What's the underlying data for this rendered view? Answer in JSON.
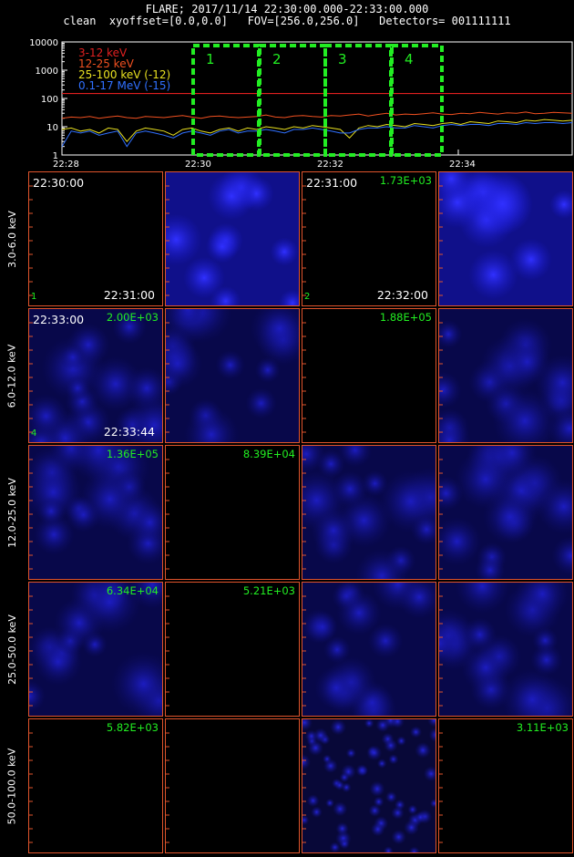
{
  "header": {
    "line1": "FLARE; 2017/11/14 22:30:00.000-22:33:00.000",
    "line2": "clean  xyoffset=[0.0,0.0]   FOV=[256.0,256.0]   Detectors= 001111111"
  },
  "chart_data": {
    "type": "line",
    "scale": "log",
    "ylim": [
      1,
      10000
    ],
    "y_ticks": [
      "10000",
      "1000",
      "100",
      "10",
      "1"
    ],
    "x_ticks": [
      "22:28",
      "22:30",
      "22:32",
      "22:34"
    ],
    "series": [
      {
        "name": "3-12 keV",
        "color": "#e02020",
        "value": 150
      },
      {
        "name": "12-25 keV",
        "color": "#f05020",
        "values": [
          20,
          22,
          21,
          23,
          20,
          22,
          24,
          21,
          20,
          23,
          22,
          21,
          23,
          25,
          22,
          20,
          23,
          24,
          22,
          21,
          22,
          23,
          26,
          22,
          21,
          24,
          25,
          23,
          22,
          25,
          24,
          26,
          28,
          24,
          27,
          30,
          26,
          28,
          27,
          29,
          31,
          28,
          27,
          30,
          29,
          32,
          30,
          28,
          31,
          30,
          33,
          29,
          30,
          32,
          31,
          30
        ]
      },
      {
        "name": "25-100 keV (-12)",
        "color": "#e8e020",
        "values": [
          8,
          9,
          7,
          8,
          6,
          9,
          8,
          3,
          7,
          9,
          8,
          7,
          5,
          8,
          9,
          7,
          6,
          8,
          9,
          7,
          9,
          8,
          10,
          9,
          8,
          10,
          9,
          11,
          10,
          9,
          8,
          4,
          9,
          11,
          10,
          12,
          11,
          10,
          13,
          12,
          11,
          13,
          14,
          12,
          15,
          14,
          13,
          16,
          15,
          14,
          17,
          16,
          18,
          17,
          16,
          17
        ]
      },
      {
        "name": "0.1-17 MeV (-15)",
        "color": "#3070ff",
        "values": [
          2,
          7,
          6,
          7,
          5,
          6,
          7,
          2,
          6,
          7,
          6,
          5,
          4,
          6,
          7,
          6,
          5,
          7,
          8,
          6,
          7,
          7,
          8,
          7,
          6,
          8,
          8,
          9,
          8,
          7,
          6,
          6,
          8,
          9,
          9,
          10,
          9,
          9,
          11,
          10,
          9,
          11,
          12,
          11,
          12,
          12,
          11,
          13,
          13,
          12,
          14,
          13,
          14,
          14,
          13,
          14
        ]
      }
    ],
    "intervals": [
      "1",
      "2",
      "3",
      "4"
    ],
    "interval_color": "#22ee22"
  },
  "panels": {
    "rows": [
      {
        "label": "3.0-6.0 keV",
        "cells": [
          {
            "max": "",
            "time": "22:30:00",
            "end": "22:31:00",
            "num": "1",
            "blobs": 0
          },
          {
            "max": "",
            "time": "",
            "end": "",
            "num": "",
            "blobs": 2
          },
          {
            "max": "1.73E+03",
            "time": "22:31:00",
            "end": "22:32:00",
            "num": "2",
            "blobs": 0
          },
          {
            "max": "",
            "time": "",
            "end": "",
            "num": "",
            "blobs": 2
          }
        ]
      },
      {
        "label": "6.0-12.0 keV",
        "cells": [
          {
            "max": "2.00E+03",
            "time": "22:33:00",
            "end": "22:33:44",
            "num": "4",
            "blobs": 1
          },
          {
            "max": "",
            "time": "",
            "end": "",
            "num": "",
            "blobs": 1
          },
          {
            "max": "1.88E+05",
            "time": "",
            "end": "",
            "num": "",
            "blobs": 0
          },
          {
            "max": "",
            "time": "",
            "end": "",
            "num": "",
            "blobs": 1
          }
        ]
      },
      {
        "label": "12.0-25.0 keV",
        "cells": [
          {
            "max": "1.36E+05",
            "time": "",
            "end": "",
            "num": "",
            "blobs": 1
          },
          {
            "max": "8.39E+04",
            "time": "",
            "end": "",
            "num": "",
            "blobs": 0
          },
          {
            "max": "",
            "time": "",
            "end": "",
            "num": "",
            "blobs": 1
          },
          {
            "max": "",
            "time": "",
            "end": "",
            "num": "",
            "blobs": 1
          }
        ]
      },
      {
        "label": "25.0-50.0 keV",
        "cells": [
          {
            "max": "6.34E+04",
            "time": "",
            "end": "",
            "num": "",
            "blobs": 1
          },
          {
            "max": "5.21E+03",
            "time": "",
            "end": "",
            "num": "",
            "blobs": 0
          },
          {
            "max": "",
            "time": "",
            "end": "",
            "num": "",
            "blobs": 1
          },
          {
            "max": "",
            "time": "",
            "end": "",
            "num": "",
            "blobs": 1
          }
        ]
      },
      {
        "label": "50.0-100.0 keV",
        "cells": [
          {
            "max": "5.82E+03",
            "time": "",
            "end": "",
            "num": "",
            "blobs": 0
          },
          {
            "max": "",
            "time": "",
            "end": "",
            "num": "",
            "blobs": 0
          },
          {
            "max": "",
            "time": "",
            "end": "",
            "num": "",
            "blobs": 3
          },
          {
            "max": "3.11E+03",
            "time": "",
            "end": "",
            "num": "",
            "blobs": 0
          }
        ]
      }
    ]
  }
}
